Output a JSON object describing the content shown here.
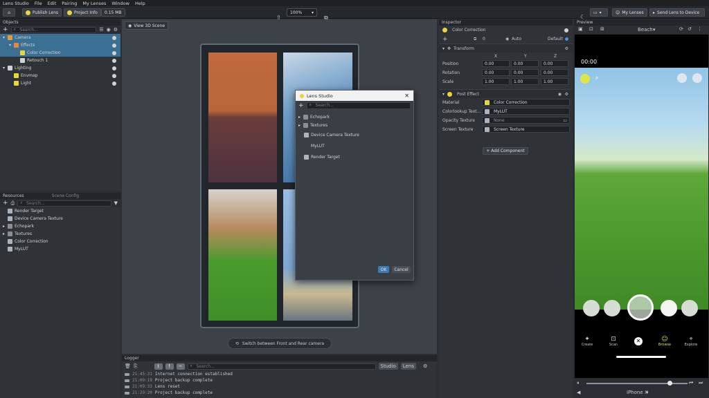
{
  "menu": [
    "Lens Studio",
    "File",
    "Edit",
    "Pairing",
    "My Lenses",
    "Window",
    "Help"
  ],
  "toolbar": {
    "publish": "Publish Lens",
    "project_info": "Project Info",
    "size": "0.15 MB",
    "zoom": "100%",
    "my_lenses": "My Lenses",
    "send": "Send Lens to Device"
  },
  "objects": {
    "title": "Objects",
    "search": "Search...",
    "items": [
      {
        "label": "Camera",
        "indent": 0,
        "sel": true
      },
      {
        "label": "Effects",
        "indent": 1,
        "sel": true
      },
      {
        "label": "Color Correction",
        "indent": 2,
        "sel": true
      },
      {
        "label": "Retouch 1",
        "indent": 2,
        "sel": false
      },
      {
        "label": "Lighting",
        "indent": 0,
        "sel": false
      },
      {
        "label": "Envmap",
        "indent": 1,
        "sel": false
      },
      {
        "label": "Light",
        "indent": 1,
        "sel": false
      }
    ]
  },
  "resources": {
    "title": "Resources",
    "tab2": "Scene Config",
    "search": "Search...",
    "items": [
      "Render Target",
      "Device Camera Texture",
      "Echopark",
      "Textures",
      "Color Correction",
      "MyLUT"
    ]
  },
  "viewport": {
    "button": "View 3D Scene",
    "switch": "Switch between Front and Rear camera"
  },
  "dialog": {
    "title": "Lens Studio",
    "search": "Search...",
    "items": [
      "Echopark",
      "Textures",
      "Device Camera Texture",
      "MyLUT",
      "Render Target"
    ],
    "ok": "OK",
    "cancel": "Cancel"
  },
  "inspector": {
    "title": "Inspector",
    "object": "Color Correction",
    "layer": "0",
    "auto": "Auto",
    "default": "Default",
    "transform": "Transform",
    "axes": [
      "X",
      "Y",
      "Z"
    ],
    "rows": [
      {
        "label": "Position",
        "v": [
          "0.00",
          "0.00",
          "0.00"
        ]
      },
      {
        "label": "Rotation",
        "v": [
          "0.00",
          "0.00",
          "0.00"
        ]
      },
      {
        "label": "Scale",
        "v": [
          "1.00",
          "1.00",
          "1.00"
        ]
      }
    ],
    "post": "Post Effect",
    "props": [
      {
        "label": "Material",
        "v": "Color Correction"
      },
      {
        "label": "Colorlookup Text...",
        "v": "MyLUT"
      },
      {
        "label": "Opacity Texture",
        "v": "None"
      },
      {
        "label": "Screen Texture",
        "v": "Screen Texture"
      }
    ],
    "add": "+ Add Component"
  },
  "preview": {
    "title": "Preview",
    "scene": "Beach",
    "timer": "00:00",
    "nav": [
      "Create",
      "Scan",
      "",
      "Browse",
      "Explore"
    ],
    "device": "iPhone X"
  },
  "logger": {
    "title": "Logger",
    "search": "Search...",
    "studio": "Studio",
    "lens": "Lens",
    "lines": [
      {
        "t": "21:45:31",
        "m": "Internet connection established"
      },
      {
        "t": "21:09:19",
        "m": "Project backup complete"
      },
      {
        "t": "21:09:33",
        "m": "Lens reset"
      },
      {
        "t": "21:29:20",
        "m": "Project backup complete"
      }
    ]
  }
}
